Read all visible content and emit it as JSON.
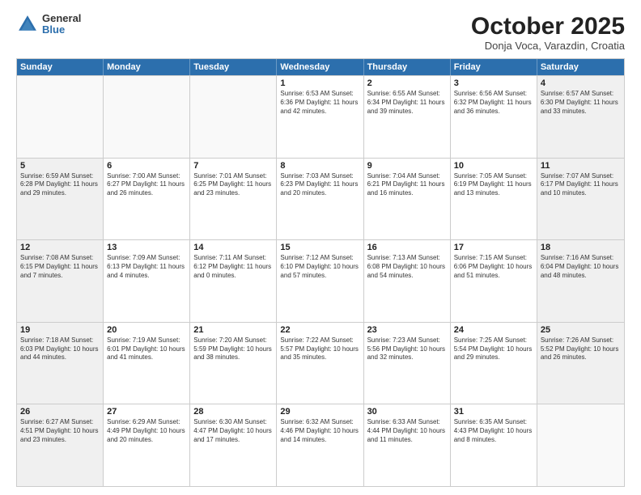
{
  "logo": {
    "general": "General",
    "blue": "Blue"
  },
  "title": "October 2025",
  "location": "Donja Voca, Varazdin, Croatia",
  "header_days": [
    "Sunday",
    "Monday",
    "Tuesday",
    "Wednesday",
    "Thursday",
    "Friday",
    "Saturday"
  ],
  "weeks": [
    [
      {
        "day": "",
        "info": "",
        "shaded": false,
        "empty": true
      },
      {
        "day": "",
        "info": "",
        "shaded": false,
        "empty": true
      },
      {
        "day": "",
        "info": "",
        "shaded": false,
        "empty": true
      },
      {
        "day": "1",
        "info": "Sunrise: 6:53 AM\nSunset: 6:36 PM\nDaylight: 11 hours\nand 42 minutes.",
        "shaded": false,
        "empty": false
      },
      {
        "day": "2",
        "info": "Sunrise: 6:55 AM\nSunset: 6:34 PM\nDaylight: 11 hours\nand 39 minutes.",
        "shaded": false,
        "empty": false
      },
      {
        "day": "3",
        "info": "Sunrise: 6:56 AM\nSunset: 6:32 PM\nDaylight: 11 hours\nand 36 minutes.",
        "shaded": false,
        "empty": false
      },
      {
        "day": "4",
        "info": "Sunrise: 6:57 AM\nSunset: 6:30 PM\nDaylight: 11 hours\nand 33 minutes.",
        "shaded": true,
        "empty": false
      }
    ],
    [
      {
        "day": "5",
        "info": "Sunrise: 6:59 AM\nSunset: 6:28 PM\nDaylight: 11 hours\nand 29 minutes.",
        "shaded": true,
        "empty": false
      },
      {
        "day": "6",
        "info": "Sunrise: 7:00 AM\nSunset: 6:27 PM\nDaylight: 11 hours\nand 26 minutes.",
        "shaded": false,
        "empty": false
      },
      {
        "day": "7",
        "info": "Sunrise: 7:01 AM\nSunset: 6:25 PM\nDaylight: 11 hours\nand 23 minutes.",
        "shaded": false,
        "empty": false
      },
      {
        "day": "8",
        "info": "Sunrise: 7:03 AM\nSunset: 6:23 PM\nDaylight: 11 hours\nand 20 minutes.",
        "shaded": false,
        "empty": false
      },
      {
        "day": "9",
        "info": "Sunrise: 7:04 AM\nSunset: 6:21 PM\nDaylight: 11 hours\nand 16 minutes.",
        "shaded": false,
        "empty": false
      },
      {
        "day": "10",
        "info": "Sunrise: 7:05 AM\nSunset: 6:19 PM\nDaylight: 11 hours\nand 13 minutes.",
        "shaded": false,
        "empty": false
      },
      {
        "day": "11",
        "info": "Sunrise: 7:07 AM\nSunset: 6:17 PM\nDaylight: 11 hours\nand 10 minutes.",
        "shaded": true,
        "empty": false
      }
    ],
    [
      {
        "day": "12",
        "info": "Sunrise: 7:08 AM\nSunset: 6:15 PM\nDaylight: 11 hours\nand 7 minutes.",
        "shaded": true,
        "empty": false
      },
      {
        "day": "13",
        "info": "Sunrise: 7:09 AM\nSunset: 6:13 PM\nDaylight: 11 hours\nand 4 minutes.",
        "shaded": false,
        "empty": false
      },
      {
        "day": "14",
        "info": "Sunrise: 7:11 AM\nSunset: 6:12 PM\nDaylight: 11 hours\nand 0 minutes.",
        "shaded": false,
        "empty": false
      },
      {
        "day": "15",
        "info": "Sunrise: 7:12 AM\nSunset: 6:10 PM\nDaylight: 10 hours\nand 57 minutes.",
        "shaded": false,
        "empty": false
      },
      {
        "day": "16",
        "info": "Sunrise: 7:13 AM\nSunset: 6:08 PM\nDaylight: 10 hours\nand 54 minutes.",
        "shaded": false,
        "empty": false
      },
      {
        "day": "17",
        "info": "Sunrise: 7:15 AM\nSunset: 6:06 PM\nDaylight: 10 hours\nand 51 minutes.",
        "shaded": false,
        "empty": false
      },
      {
        "day": "18",
        "info": "Sunrise: 7:16 AM\nSunset: 6:04 PM\nDaylight: 10 hours\nand 48 minutes.",
        "shaded": true,
        "empty": false
      }
    ],
    [
      {
        "day": "19",
        "info": "Sunrise: 7:18 AM\nSunset: 6:03 PM\nDaylight: 10 hours\nand 44 minutes.",
        "shaded": true,
        "empty": false
      },
      {
        "day": "20",
        "info": "Sunrise: 7:19 AM\nSunset: 6:01 PM\nDaylight: 10 hours\nand 41 minutes.",
        "shaded": false,
        "empty": false
      },
      {
        "day": "21",
        "info": "Sunrise: 7:20 AM\nSunset: 5:59 PM\nDaylight: 10 hours\nand 38 minutes.",
        "shaded": false,
        "empty": false
      },
      {
        "day": "22",
        "info": "Sunrise: 7:22 AM\nSunset: 5:57 PM\nDaylight: 10 hours\nand 35 minutes.",
        "shaded": false,
        "empty": false
      },
      {
        "day": "23",
        "info": "Sunrise: 7:23 AM\nSunset: 5:56 PM\nDaylight: 10 hours\nand 32 minutes.",
        "shaded": false,
        "empty": false
      },
      {
        "day": "24",
        "info": "Sunrise: 7:25 AM\nSunset: 5:54 PM\nDaylight: 10 hours\nand 29 minutes.",
        "shaded": false,
        "empty": false
      },
      {
        "day": "25",
        "info": "Sunrise: 7:26 AM\nSunset: 5:52 PM\nDaylight: 10 hours\nand 26 minutes.",
        "shaded": true,
        "empty": false
      }
    ],
    [
      {
        "day": "26",
        "info": "Sunrise: 6:27 AM\nSunset: 4:51 PM\nDaylight: 10 hours\nand 23 minutes.",
        "shaded": true,
        "empty": false
      },
      {
        "day": "27",
        "info": "Sunrise: 6:29 AM\nSunset: 4:49 PM\nDaylight: 10 hours\nand 20 minutes.",
        "shaded": false,
        "empty": false
      },
      {
        "day": "28",
        "info": "Sunrise: 6:30 AM\nSunset: 4:47 PM\nDaylight: 10 hours\nand 17 minutes.",
        "shaded": false,
        "empty": false
      },
      {
        "day": "29",
        "info": "Sunrise: 6:32 AM\nSunset: 4:46 PM\nDaylight: 10 hours\nand 14 minutes.",
        "shaded": false,
        "empty": false
      },
      {
        "day": "30",
        "info": "Sunrise: 6:33 AM\nSunset: 4:44 PM\nDaylight: 10 hours\nand 11 minutes.",
        "shaded": false,
        "empty": false
      },
      {
        "day": "31",
        "info": "Sunrise: 6:35 AM\nSunset: 4:43 PM\nDaylight: 10 hours\nand 8 minutes.",
        "shaded": false,
        "empty": false
      },
      {
        "day": "",
        "info": "",
        "shaded": true,
        "empty": true
      }
    ]
  ]
}
